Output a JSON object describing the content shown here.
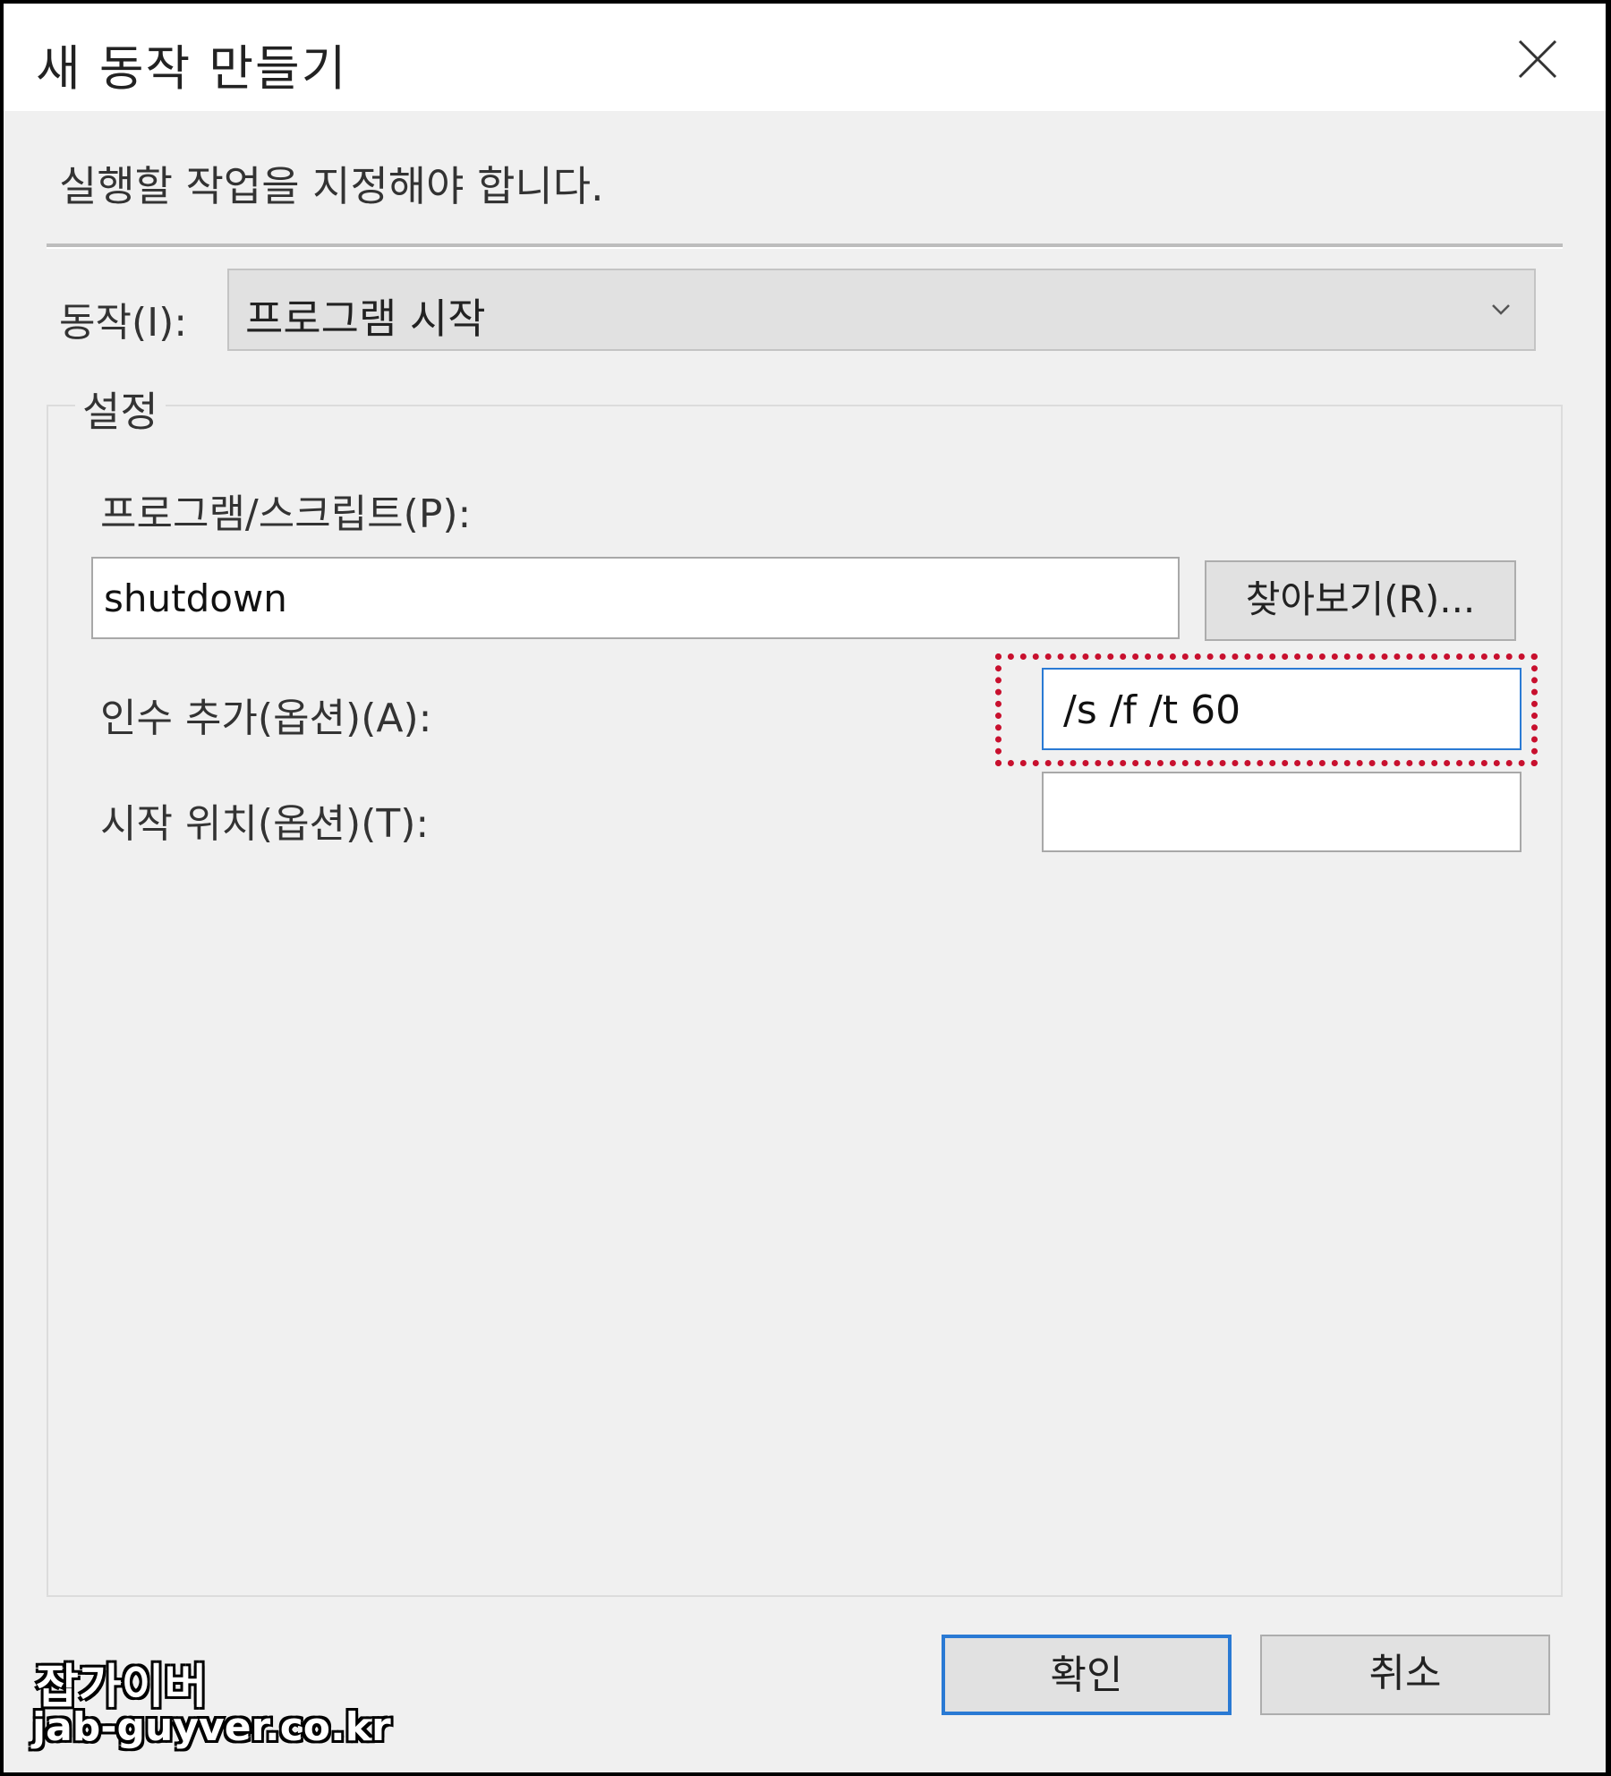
{
  "window": {
    "title": "새 동작 만들기",
    "close_icon": "close-icon"
  },
  "instruction": "실행할 작업을 지정해야 합니다.",
  "action": {
    "label": "동작(I):",
    "selected": "프로그램 시작",
    "arrow_icon": "chevron-down-icon"
  },
  "settings": {
    "legend": "설정",
    "program_label": "프로그램/스크립트(P):",
    "program_value": "shutdown",
    "browse_label": "찾아보기(R)...",
    "args_label": "인수 추가(옵션)(A):",
    "args_value": "/s /f /t 60",
    "start_label": "시작 위치(옵션)(T):",
    "start_value": ""
  },
  "buttons": {
    "ok": "확인",
    "cancel": "취소"
  },
  "highlight_color": "#c8102e",
  "watermark": {
    "line1": "잡가이버",
    "line2": "jab-guyver.co.kr"
  }
}
